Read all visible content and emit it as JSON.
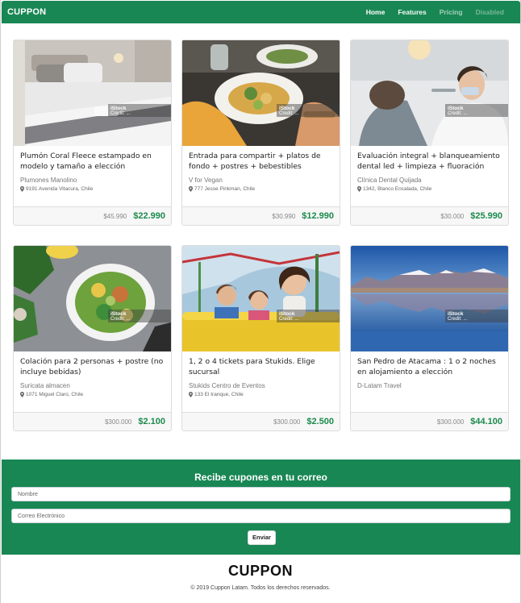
{
  "navbar": {
    "brand": "CUPPON",
    "links": [
      {
        "label": "Home"
      },
      {
        "label": "Features"
      },
      {
        "label": "Pricing"
      },
      {
        "label": "Disabled"
      }
    ]
  },
  "watermark": {
    "title": "iStock",
    "credit": "Credit: ..."
  },
  "deals": [
    {
      "title": "Plumón Coral Fleece estampado en modelo y tamaño a elección",
      "merchant": "Plumones Manolino",
      "address": "9191 Avenida Vitacura, Chile",
      "old_price": "$45.990",
      "new_price": "$22.990",
      "image": "bedroom"
    },
    {
      "title": "Entrada para compartir + platos de fondo + postres + bebestibles",
      "merchant": "V for Vegan",
      "address": "777 Jesse Pinkman, Chile",
      "old_price": "$30.990",
      "new_price": "$12.990",
      "image": "salad-table"
    },
    {
      "title": "Evaluación integral + blanqueamiento dental led + limpieza + fluoración",
      "merchant": "Clínica Dental Quijada",
      "address": "1342, Blanco Encalada, Chile",
      "old_price": "$30.000",
      "new_price": "$25.990",
      "image": "dentist"
    },
    {
      "title": "Colación para 2 personas + postre (no incluye bebidas)",
      "merchant": "Suricata almacen",
      "address": "1071 Miguel Claro, Chile",
      "old_price": "$300.000",
      "new_price": "$2.100",
      "image": "salad-bowl"
    },
    {
      "title": "1, 2 o 4 tickets para Stukids. Elige sucursal",
      "merchant": "Stukids Centro de Eventos",
      "address": "133 El tranque, Chile",
      "old_price": "$300.000",
      "new_price": "$2.500",
      "image": "amusement-ride"
    },
    {
      "title": "San Pedro de Atacama : 1 o 2 noches en alojamiento a elección",
      "merchant": "D-Latam Travel",
      "address": "",
      "old_price": "$300.000",
      "new_price": "$44.100",
      "image": "mountain-lake"
    }
  ],
  "subscribe": {
    "title": "Recibe cupones en tu correo",
    "name_placeholder": "Nombre",
    "email_placeholder": "Correo Electrónico",
    "submit_label": "Enviar"
  },
  "footer": {
    "brand": "CUPPON",
    "copyright": "© 2019 Cuppon Latam. Todos los derechos reservados."
  },
  "colors": {
    "brand_green": "#198754",
    "price_green": "#1b8a4c"
  }
}
